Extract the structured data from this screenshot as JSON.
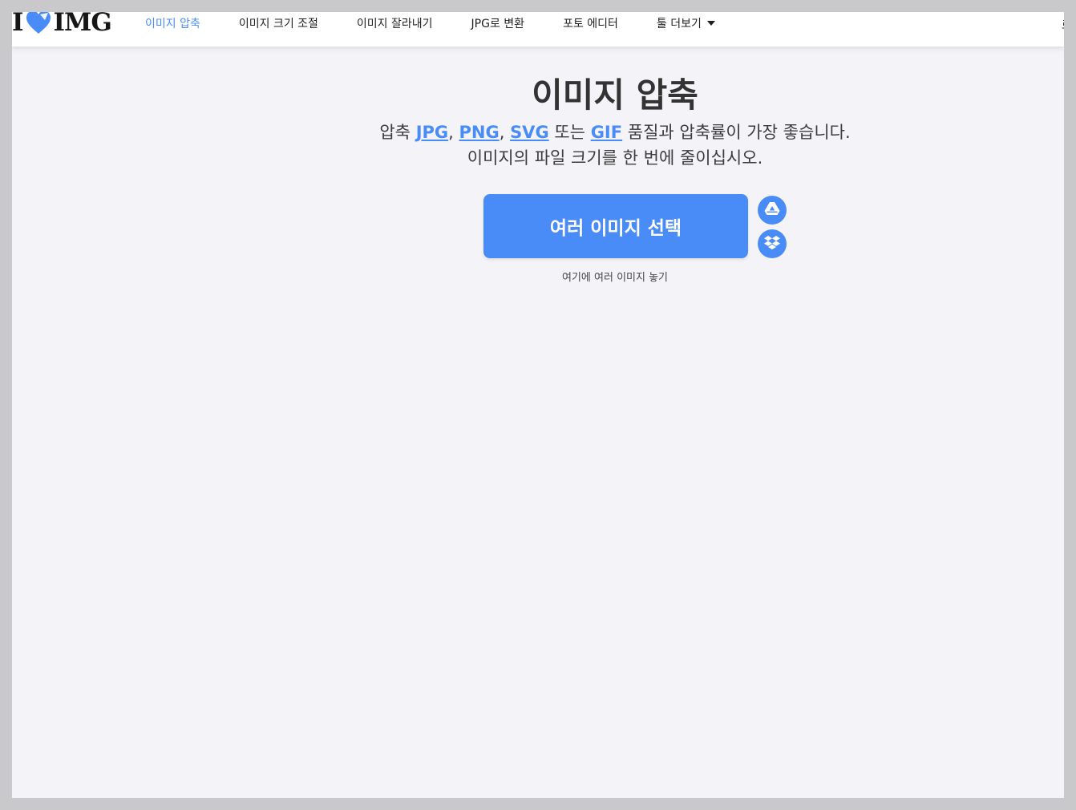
{
  "header": {
    "logo_left": "I",
    "logo_right": "IMG",
    "nav": [
      {
        "label": "이미지 압축",
        "active": true
      },
      {
        "label": "이미지 크기 조절",
        "active": false
      },
      {
        "label": "이미지 잘라내기",
        "active": false
      },
      {
        "label": "JPG로 변환",
        "active": false
      },
      {
        "label": "포토 에디터",
        "active": false
      },
      {
        "label": "툴 더보기",
        "active": false,
        "icon": "caret-down-icon"
      }
    ],
    "login_label": "로그"
  },
  "main": {
    "title": "이미지 압축",
    "subtitle": {
      "prefix": "압축 ",
      "formats": [
        "JPG",
        "PNG",
        "SVG",
        "GIF"
      ],
      "sep1": ", ",
      "sep2": ", ",
      "sep3": " 또는 ",
      "suffix": " 품질과 압축률이 가장 좋습니다.",
      "line2": "이미지의 파일 크기를 한 번에 줄이십시오."
    },
    "select_button_label": "여러 이미지 선택",
    "cloud_buttons": [
      "google-drive-icon",
      "dropbox-icon"
    ],
    "drop_hint": "여기에 여러 이미지 놓기"
  },
  "colors": {
    "accent": "#4a8cf7",
    "page_bg": "#f4f4f8",
    "outer_bg": "#c9c9cb",
    "text_dark": "#333333"
  }
}
